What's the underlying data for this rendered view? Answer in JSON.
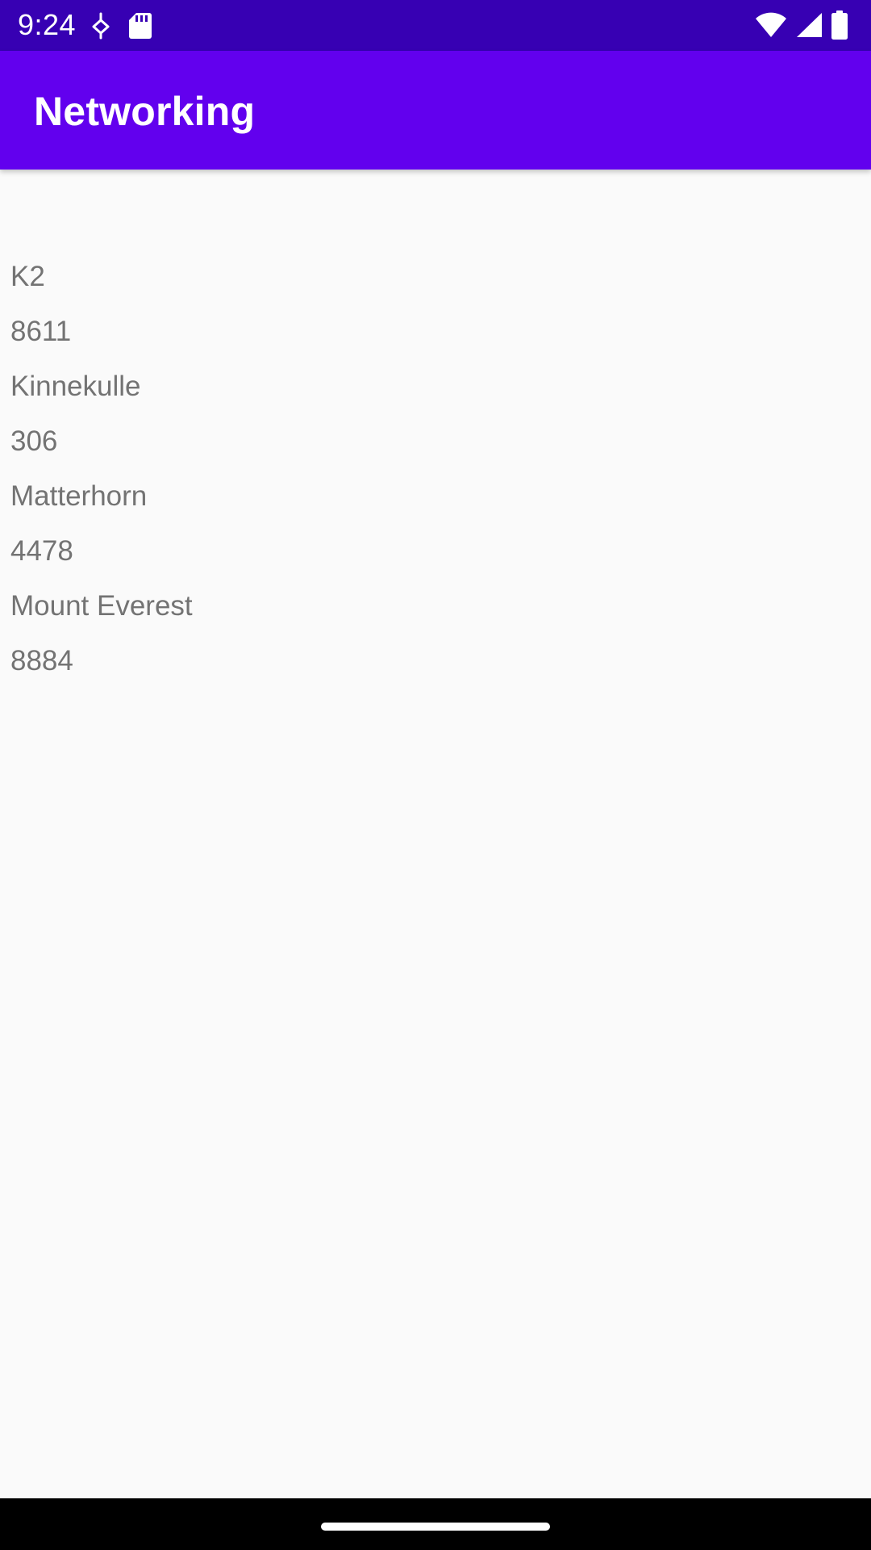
{
  "status_bar": {
    "time": "9:24",
    "left_icons": [
      "usb-debug-icon",
      "sd-card-icon"
    ],
    "right_icons": [
      "wifi-icon",
      "cellular-signal-icon",
      "battery-icon"
    ],
    "background_color": "#3700b3"
  },
  "app_bar": {
    "title": "Networking",
    "background_color": "#6200ee"
  },
  "mountains": [
    {
      "name": "K2",
      "height": "8611"
    },
    {
      "name": "Kinnekulle",
      "height": "306"
    },
    {
      "name": "Matterhorn",
      "height": "4478"
    },
    {
      "name": "Mount Everest",
      "height": "8884"
    }
  ],
  "nav_bar": {
    "handle": "home-gesture-handle"
  }
}
